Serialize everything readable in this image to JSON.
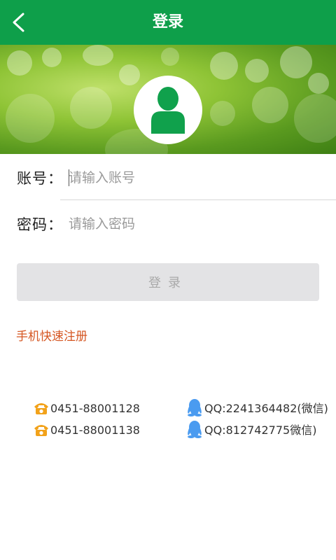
{
  "header": {
    "title": "登录",
    "back_icon": "chevron-left-icon"
  },
  "colors": {
    "header_bg": "#0e9f4a",
    "avatar_icon": "#10a14c",
    "register_link": "#d55622",
    "login_button_bg": "#e3e3e5",
    "login_button_text": "#a9a9a9",
    "qq_icon": "#4a9bf0",
    "phone_icon": "#f2a21a"
  },
  "banner": {
    "avatar_icon": "user-icon"
  },
  "form": {
    "account": {
      "label": "账号",
      "colon": "：",
      "value": "",
      "placeholder": "请输入账号"
    },
    "password": {
      "label": "密码",
      "colon": "：",
      "value": "",
      "placeholder": "请输入密码"
    },
    "login_button": "登录",
    "register_link": "手机快速注册"
  },
  "contacts": {
    "phones": [
      {
        "icon": "phone-icon",
        "text": "0451-88001128"
      },
      {
        "icon": "phone-icon",
        "text": "0451-88001138"
      }
    ],
    "qq": [
      {
        "icon": "qq-icon",
        "text": "QQ:2241364482(微信)"
      },
      {
        "icon": "qq-icon",
        "text": "QQ:812742775微信)"
      }
    ]
  }
}
